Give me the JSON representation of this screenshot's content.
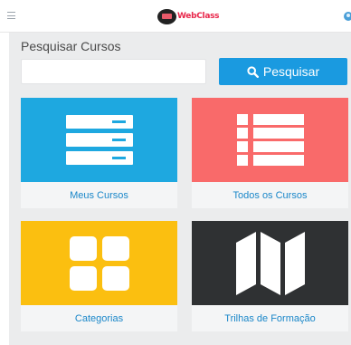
{
  "header": {
    "logo_text": "WebClass",
    "menu_icon": "hamburger-icon",
    "user_icon": "user-icon"
  },
  "search": {
    "title": "Pesquisar Cursos",
    "placeholder": "",
    "value": "",
    "button_label": "Pesquisar",
    "button_icon": "search-icon"
  },
  "tiles": [
    {
      "label": "Meus Cursos",
      "icon": "stacked-list-icon",
      "color": "#1ea8e0"
    },
    {
      "label": "Todos os Cursos",
      "icon": "bulleted-list-icon",
      "color": "#f96a6a"
    },
    {
      "label": "Categorias",
      "icon": "grid-icon",
      "color": "#fbbf10"
    },
    {
      "label": "Trilhas de Formação",
      "icon": "map-icon",
      "color": "#2f3133"
    }
  ],
  "colors": {
    "accent": "#1a9ae0",
    "tile_label": "#1a87c9",
    "panel_bg": "#ebeced"
  }
}
